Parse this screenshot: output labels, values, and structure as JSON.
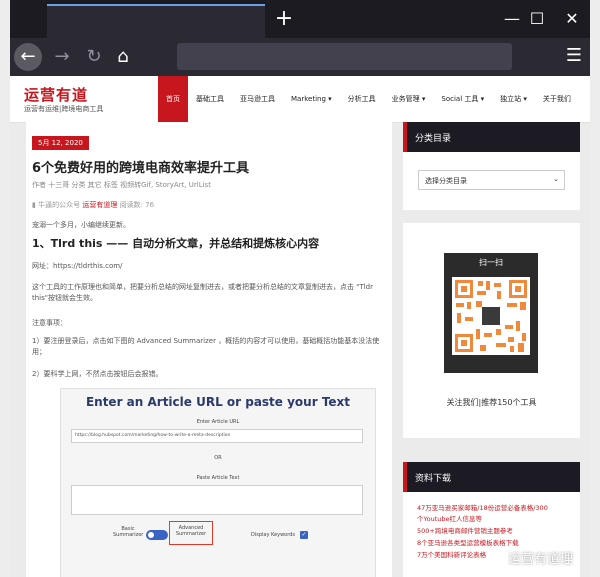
{
  "browser": {
    "new_tab": "+",
    "minimize": "—",
    "maximize": "☐",
    "close": "✕",
    "back": "←",
    "forward": "→",
    "reload": "↻",
    "home": "⌂",
    "menu": "☰"
  },
  "site": {
    "logo": "运营有道",
    "tagline": "运营有运维|跨境电商工具",
    "nav": [
      "首页",
      "基础工具",
      "亚马逊工具",
      "Marketing ▾",
      "分析工具",
      "业务管理 ▾",
      "Social 工具 ▾",
      "独立站 ▾",
      "关于我们"
    ]
  },
  "article": {
    "date": "5月 12, 2020",
    "title": "6个免费好用的跨境电商效率提升工具",
    "meta": "作者  十三哥   分类 其它   标签 视频转Gif, StoryArt, UrlList",
    "source_prefix": "牛逼的公众号",
    "source_name": "运营有道理",
    "source_suffix": "阅读数: 76",
    "intro": "宠溺一个多月，小编继续更新。",
    "heading": "1、Tlrd this —— 自动分析文章，并总结和提炼核心内容",
    "url_line": "网址：https://tldrthis.com/",
    "para1": "这个工具的工作原理也和简单，把要分析总结的网址复制进去，或者把要分析总结的文章复制进去，点击 \"Tldr this\"按钮就会生效。",
    "notes_title": "注意事项：",
    "note1": "1）要注册登录后，点击如下图的 Advanced Summarizer ，概括的内容才可以使用，基础概括功能基本没法使用；",
    "note2": "2）要科学上网，不然点击按钮后会报错。"
  },
  "screenshot": {
    "title": "Enter an Article URL or paste your Text",
    "url_label": "Enter Article URL",
    "url_value": "https://blog.hubspot.com/marketing/how-to-write-a-meta-description",
    "or": "OR",
    "paste_label": "Paste Article Text",
    "basic": "Basic Summarizer",
    "advanced": "Advanced Summarizer",
    "display_keywords": "Display Keywords",
    "check": "✓"
  },
  "sidebar": {
    "categories_title": "分类目录",
    "categories_select": "选择分类目录",
    "scan_text": "扫一扫",
    "follow_text": "关注我们|推荐150个工具",
    "downloads_title": "资料下载",
    "downloads": [
      "47万亚马逊买家邮箱/18份运营必备表格/300",
      "个Youtube红人信息等",
      "500+跨境电商邮件营销主题参考",
      "8个亚马逊各类型运营模板表格下载",
      "7万个美国科新评论表格"
    ]
  },
  "watermark": "运营有道理"
}
